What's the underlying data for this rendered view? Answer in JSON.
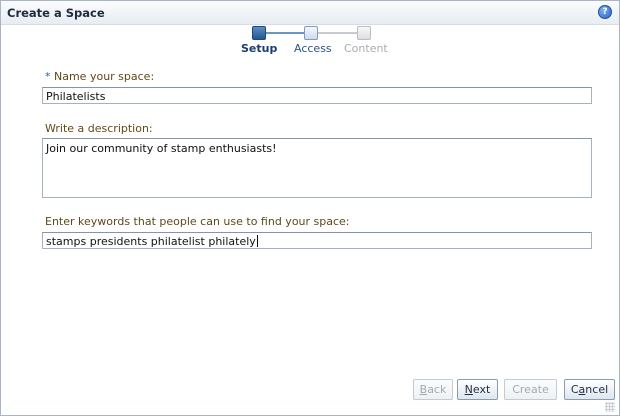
{
  "dialog": {
    "title": "Create a Space",
    "help_icon": "help-icon",
    "help_glyph": "?"
  },
  "train": {
    "steps": [
      {
        "label": "Setup",
        "state": "current"
      },
      {
        "label": "Access",
        "state": "next"
      },
      {
        "label": "Content",
        "state": "disabled"
      }
    ]
  },
  "form": {
    "required_marker": "*",
    "name_label": "Name your space:",
    "name_value": "Philatelists",
    "description_label": "Write a description:",
    "description_value": "Join our community of stamp enthusiasts!",
    "keywords_label": "Enter keywords that people can use to find your space:",
    "keywords_value": "stamps presidents philatelist philately"
  },
  "buttons": {
    "back_mnemonic": "B",
    "back_rest": "ack",
    "next_mnemonic": "N",
    "next_rest": "ext",
    "create": "Create",
    "cancel_prefix": "C",
    "cancel_mnemonic": "a",
    "cancel_rest": "ncel"
  }
}
